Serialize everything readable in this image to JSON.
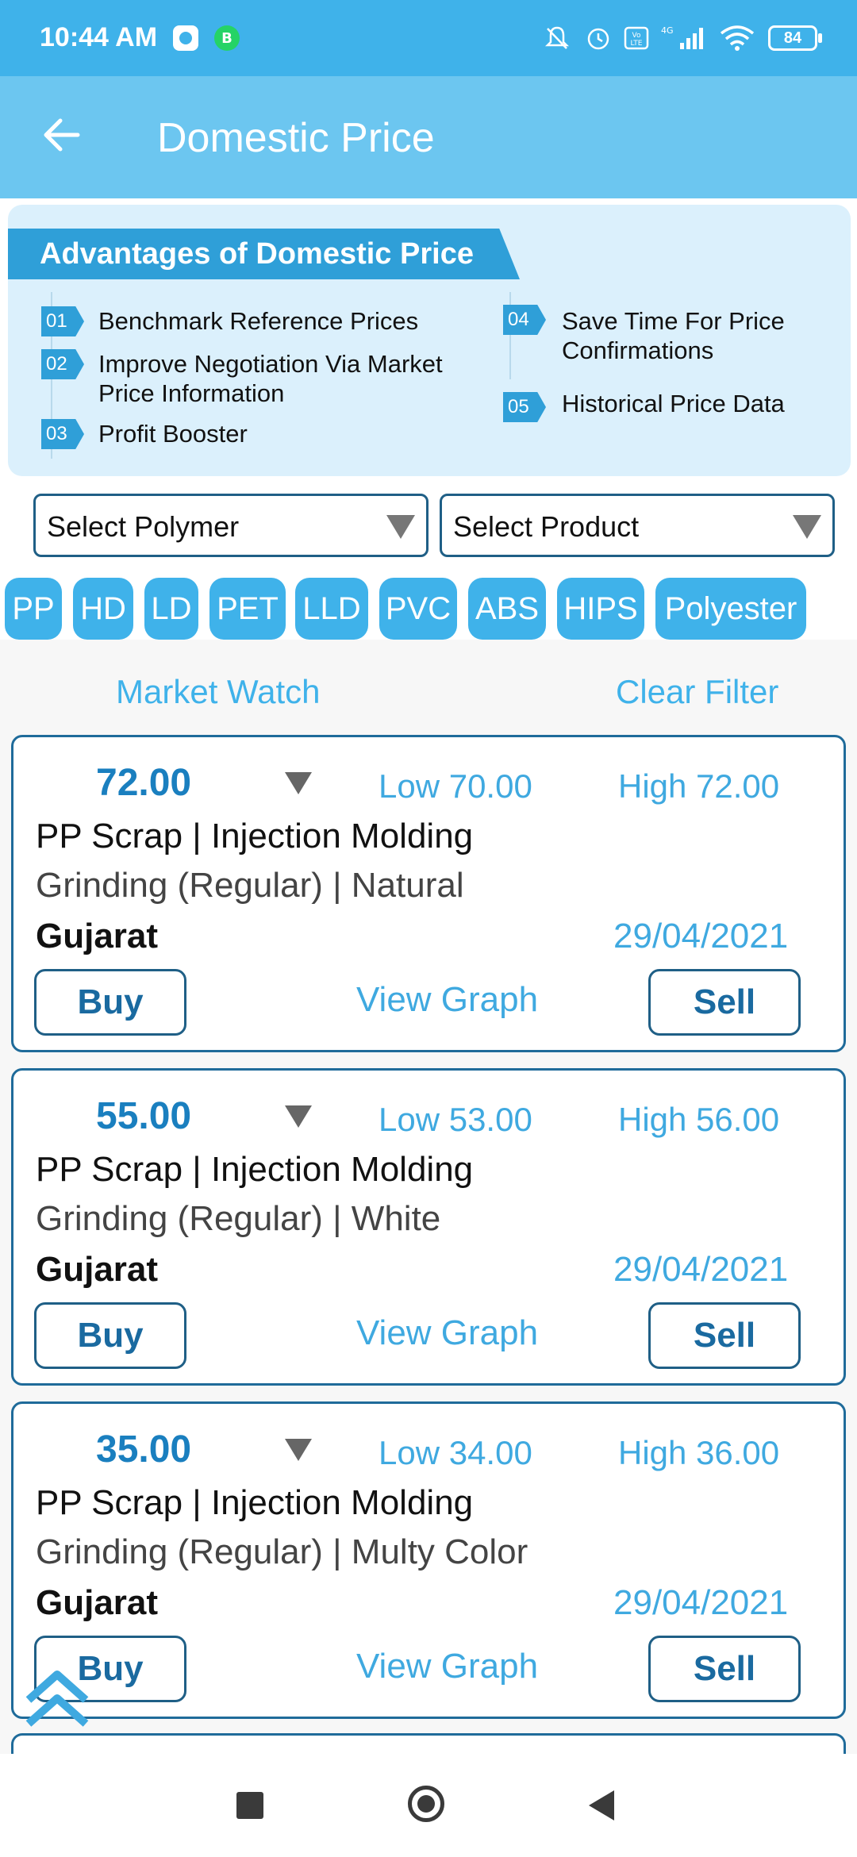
{
  "status_bar": {
    "time": "10:44 AM",
    "battery": "84",
    "network": "4G"
  },
  "header": {
    "title": "Domestic Price"
  },
  "advantages": {
    "title": "Advantages of Domestic Price",
    "items": [
      {
        "num": "01",
        "text": "Benchmark Reference Prices"
      },
      {
        "num": "02",
        "text": "Improve Negotiation Via Market Price Information"
      },
      {
        "num": "03",
        "text": "Profit Booster"
      },
      {
        "num": "04",
        "text": "Save Time For Price Confirmations"
      },
      {
        "num": "05",
        "text": "Historical Price Data"
      }
    ]
  },
  "filters": {
    "polymer": "Select Polymer",
    "product": "Select Product"
  },
  "chips": [
    "PP",
    "HD",
    "LD",
    "PET",
    "LLD",
    "PVC",
    "ABS",
    "HIPS",
    "Polyester"
  ],
  "list_header": {
    "market_watch": "Market Watch",
    "clear_filter": "Clear Filter"
  },
  "cards": [
    {
      "price": "72.00",
      "low": "Low 70.00",
      "high": "High 72.00",
      "line1": "PP Scrap | Injection Molding",
      "line2": "Grinding (Regular) | Natural",
      "location": "Gujarat",
      "date": "29/04/2021",
      "buy": "Buy",
      "graph": "View Graph",
      "sell": "Sell"
    },
    {
      "price": "55.00",
      "low": "Low 53.00",
      "high": "High 56.00",
      "line1": "PP Scrap | Injection Molding",
      "line2": "Grinding (Regular) | White",
      "location": "Gujarat",
      "date": "29/04/2021",
      "buy": "Buy",
      "graph": "View Graph",
      "sell": "Sell"
    },
    {
      "price": "35.00",
      "low": "Low 34.00",
      "high": "High 36.00",
      "line1": "PP Scrap | Injection Molding",
      "line2": "Grinding (Regular) | Multy Color",
      "location": "Gujarat",
      "date": "29/04/2021",
      "buy": "Buy",
      "graph": "View Graph",
      "sell": "Sell"
    }
  ],
  "colors": {
    "primary": "#3fb2ea",
    "header": "#6cc6f0",
    "accent_dark": "#1f5f86"
  }
}
